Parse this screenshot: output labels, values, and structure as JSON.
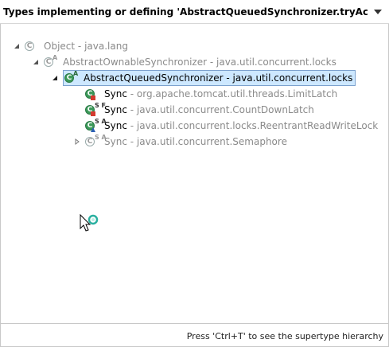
{
  "header": {
    "title": "Types implementing or defining 'AbstractQueuedSynchronizer.tryAcquireSl",
    "menu_icon": "chevron-down-icon"
  },
  "tree": {
    "separator": " - ",
    "nodes": [
      {
        "name": "Object",
        "package": "java.lang",
        "expanded": true,
        "selected": false,
        "dimmed": true,
        "icon": "class-icon",
        "modifier": ""
      },
      {
        "name": "AbstractOwnableSynchronizer",
        "package": "java.util.concurrent.locks",
        "expanded": true,
        "selected": false,
        "dimmed": true,
        "icon": "abstract-class-icon",
        "modifier": "A"
      },
      {
        "name": "AbstractQueuedSynchronizer",
        "package": "java.util.concurrent.locks",
        "expanded": true,
        "selected": true,
        "dimmed": false,
        "icon": "abstract-class-icon",
        "modifier": "A"
      },
      {
        "name": "Sync",
        "package": "org.apache.tomcat.util.threads.LimitLatch",
        "expanded": false,
        "selected": false,
        "dimmed": false,
        "icon": "private-inner-class-icon",
        "modifier": ""
      },
      {
        "name": "Sync",
        "package": "java.util.concurrent.CountDownLatch",
        "expanded": false,
        "selected": false,
        "dimmed": false,
        "icon": "private-static-final-inner-class-icon",
        "modifier": "S F"
      },
      {
        "name": "Sync",
        "package": "java.util.concurrent.locks.ReentrantReadWriteLock",
        "expanded": false,
        "selected": false,
        "dimmed": false,
        "icon": "abstract-static-inner-class-icon",
        "modifier": "S A"
      },
      {
        "name": "Sync",
        "package": "java.util.concurrent.Semaphore",
        "expanded": false,
        "selected": false,
        "dimmed": true,
        "icon": "abstract-static-inner-class-icon",
        "modifier": "S A",
        "collapsible": true
      }
    ]
  },
  "status": {
    "text": "Press 'Ctrl+T' to see the supertype hierarchy"
  },
  "colors": {
    "class_green": "#2e8b57",
    "private_red": "#d43a2f",
    "protected_yellow": "#e0b020",
    "selected_bg": "#cde8ff",
    "selected_border": "#7da2ce",
    "dim_text": "#8a8a8a"
  }
}
